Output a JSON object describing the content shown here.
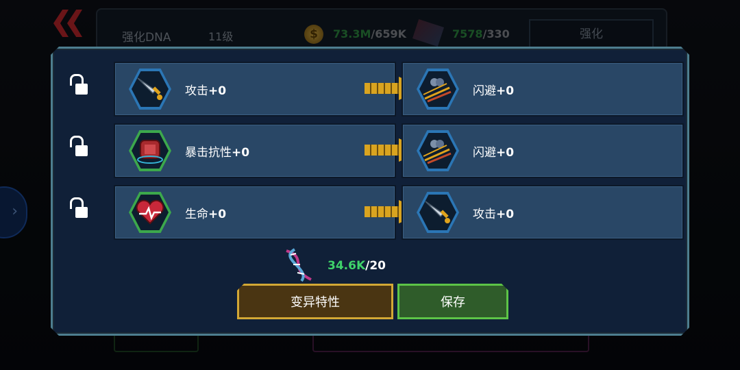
{
  "header": {
    "title": "强化DNA",
    "level": "11级",
    "gold_have": "73.3M",
    "gold_need": "/659K",
    "material_have": "7578",
    "material_need": "/330",
    "tab_label": "强化"
  },
  "rows": [
    {
      "left_label": "攻击",
      "left_value": "+0",
      "right_label": "闪避",
      "right_value": "+0",
      "left_icon": "sword-icon",
      "right_icon": "evade-icon"
    },
    {
      "left_label": "暴击抗性",
      "left_value": "+0",
      "right_label": "闪避",
      "right_value": "+0",
      "left_icon": "armor-icon",
      "right_icon": "evade-icon"
    },
    {
      "left_label": "生命",
      "left_value": "+0",
      "right_label": "攻击",
      "right_value": "+0",
      "left_icon": "heart-icon",
      "right_icon": "sword-icon"
    }
  ],
  "cost": {
    "have": "34.6K",
    "need": "/20"
  },
  "buttons": {
    "mutate": "变异特性",
    "save": "保存"
  },
  "colors": {
    "have_green": "#3fd36a",
    "mutate_border": "#d3a835",
    "save_border": "#5dc447",
    "hex_blue": "#2b76b5",
    "hex_green": "#3ca84c"
  }
}
